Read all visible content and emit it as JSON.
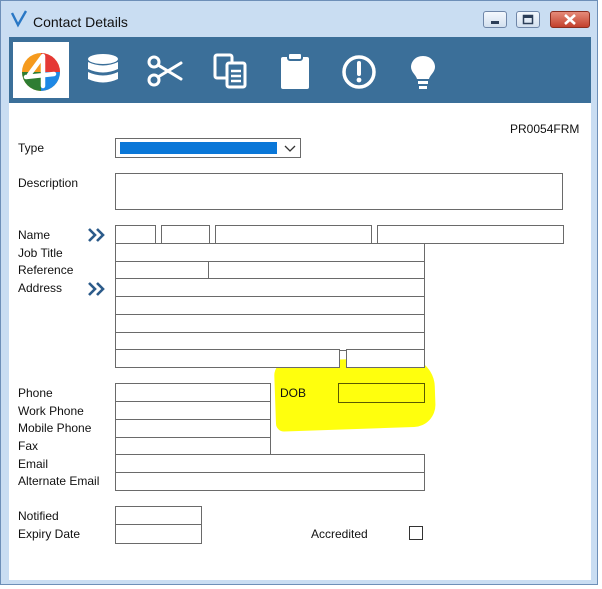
{
  "window": {
    "title": "Contact Details"
  },
  "toolbar": {
    "items": [
      "app-logo",
      "database",
      "scissors",
      "copy",
      "clipboard",
      "alert",
      "lightbulb"
    ]
  },
  "form": {
    "form_code": "PR0054FRM",
    "type_label": "Type",
    "description_label": "Description",
    "name_label": "Name",
    "job_title_label": "Job Title",
    "reference_label": "Reference",
    "address_label": "Address",
    "phone_label": "Phone",
    "work_phone_label": "Work Phone",
    "mobile_phone_label": "Mobile Phone",
    "fax_label": "Fax",
    "email_label": "Email",
    "alternate_email_label": "Alternate Email",
    "dob_label": "DOB",
    "notified_label": "Notified",
    "expiry_date_label": "Expiry Date",
    "accredited_label": "Accredited",
    "type_value": "",
    "accredited_checked": false
  },
  "colors": {
    "toolbar": "#3b6f99",
    "highlight": "#ffff00",
    "select_fill": "#0a77d8"
  }
}
